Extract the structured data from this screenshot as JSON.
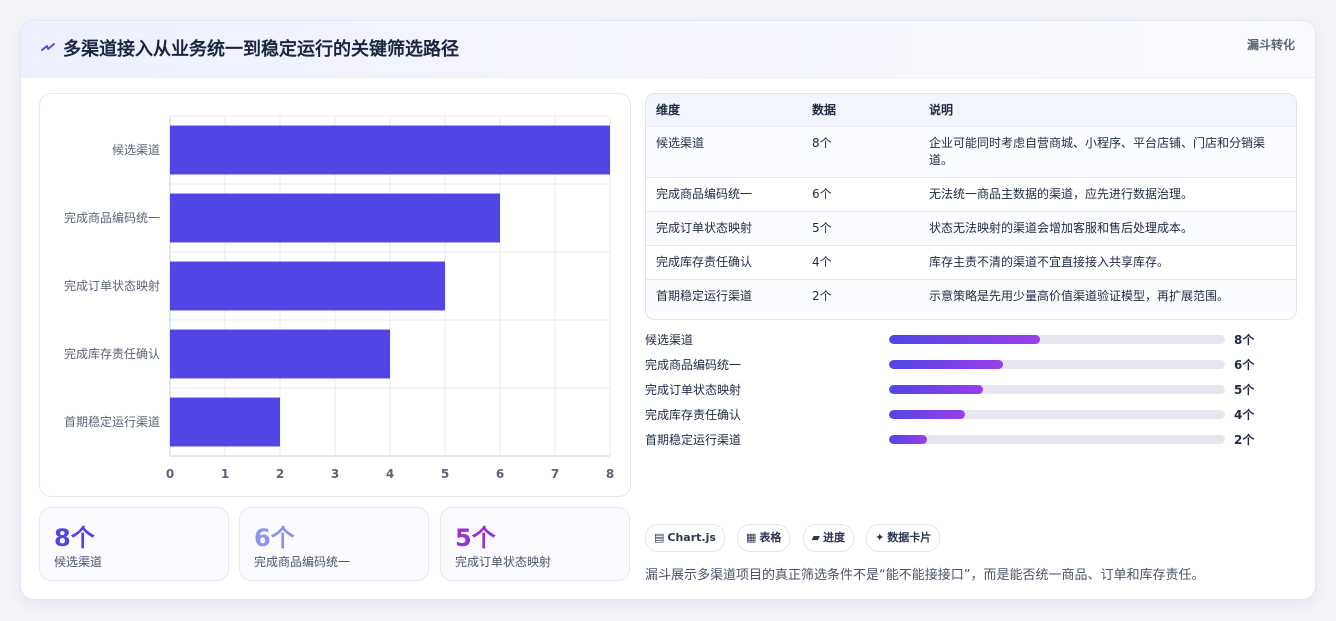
{
  "header": {
    "title": "多渠道接入从业务统一到稳定运行的关键筛选路径",
    "tag": "漏斗转化"
  },
  "chart_data": {
    "type": "bar",
    "orientation": "horizontal",
    "categories": [
      "候选渠道",
      "完成商品编码统一",
      "完成订单状态映射",
      "完成库存责任确认",
      "首期稳定运行渠道"
    ],
    "values": [
      8,
      6,
      5,
      4,
      2
    ],
    "xlim": [
      0,
      8
    ],
    "xticks": [
      "0",
      "1",
      "2",
      "3",
      "4",
      "5",
      "6",
      "7",
      "8"
    ],
    "grid": true,
    "color": "#5146e5"
  },
  "stats": [
    {
      "value": "8个",
      "label": "候选渠道",
      "color": "#5146e5"
    },
    {
      "value": "6个",
      "label": "完成商品编码统一",
      "color": "#8b93ee"
    },
    {
      "value": "5个",
      "label": "完成订单状态映射",
      "color": "#9b2fd0"
    }
  ],
  "table": {
    "headers": [
      "维度",
      "数据",
      "说明"
    ],
    "rows": [
      {
        "dim": "候选渠道",
        "data": "8个",
        "desc": "企业可能同时考虑自营商城、小程序、平台店铺、门店和分销渠道。"
      },
      {
        "dim": "完成商品编码统一",
        "data": "6个",
        "desc": "无法统一商品主数据的渠道，应先进行数据治理。"
      },
      {
        "dim": "完成订单状态映射",
        "data": "5个",
        "desc": "状态无法映射的渠道会增加客服和售后处理成本。"
      },
      {
        "dim": "完成库存责任确认",
        "data": "4个",
        "desc": "库存主责不清的渠道不宜直接接入共享库存。"
      },
      {
        "dim": "首期稳定运行渠道",
        "data": "2个",
        "desc": "示意策略是先用少量高价值渠道验证模型，再扩展范围。"
      }
    ]
  },
  "progress": [
    {
      "label": "候选渠道",
      "value": "8个",
      "fraction": 0.45
    },
    {
      "label": "完成商品编码统一",
      "value": "6个",
      "fraction": 0.34
    },
    {
      "label": "完成订单状态映射",
      "value": "5个",
      "fraction": 0.28
    },
    {
      "label": "完成库存责任确认",
      "value": "4个",
      "fraction": 0.225
    },
    {
      "label": "首期稳定运行渠道",
      "value": "2个",
      "fraction": 0.112
    }
  ],
  "chips": [
    {
      "icon": "chart-icon",
      "glyph": "▤",
      "label": "Chart.js"
    },
    {
      "icon": "table-icon",
      "glyph": "▦",
      "label": "表格"
    },
    {
      "icon": "progress-icon",
      "glyph": "▰",
      "label": "进度"
    },
    {
      "icon": "card-icon",
      "glyph": "✦",
      "label": "数据卡片"
    }
  ],
  "footnote": "漏斗展示多渠道项目的真正筛选条件不是“能不能接接口”，而是能否统一商品、订单和库存责任。"
}
